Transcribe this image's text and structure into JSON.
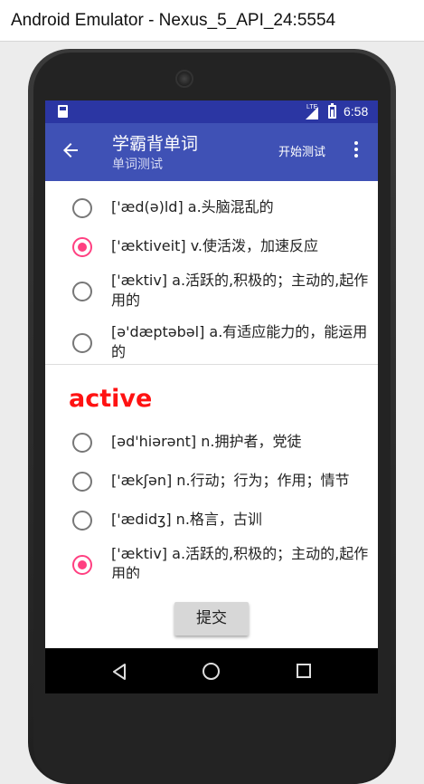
{
  "window": {
    "title": "Android Emulator - Nexus_5_API_24:5554"
  },
  "statusbar": {
    "time": "6:58",
    "network": "LTE"
  },
  "toolbar": {
    "title": "学霸背单词",
    "subtitle": "单词测试",
    "action_label": "开始测试"
  },
  "top_options": [
    {
      "text": "['æd(ə)ld] a.头脑混乱的",
      "selected": false
    },
    {
      "text": "['æktiveit] v.使活泼，加速反应",
      "selected": true
    },
    {
      "text": "['æktiv] a.活跃的,积极的；主动的,起作用的",
      "selected": false
    },
    {
      "text": "[ə'dæptəbəl] a.有适应能力的，能运用的",
      "selected": false
    }
  ],
  "quiz_word": "active",
  "bottom_options": [
    {
      "text": "[əd'hiərənt] n.拥护者，党徒",
      "selected": false
    },
    {
      "text": "['ækʃən] n.行动；行为；作用；情节",
      "selected": false
    },
    {
      "text": "['ædidʒ] n.格言，古训",
      "selected": false
    },
    {
      "text": "['æktiv] a.活跃的,积极的；主动的,起作用的",
      "selected": true
    }
  ],
  "submit_label": "提交",
  "colors": {
    "primary": "#3f51b5",
    "primary_dark": "#2b36a3",
    "accent": "#ff4081",
    "word": "#ff1212"
  }
}
